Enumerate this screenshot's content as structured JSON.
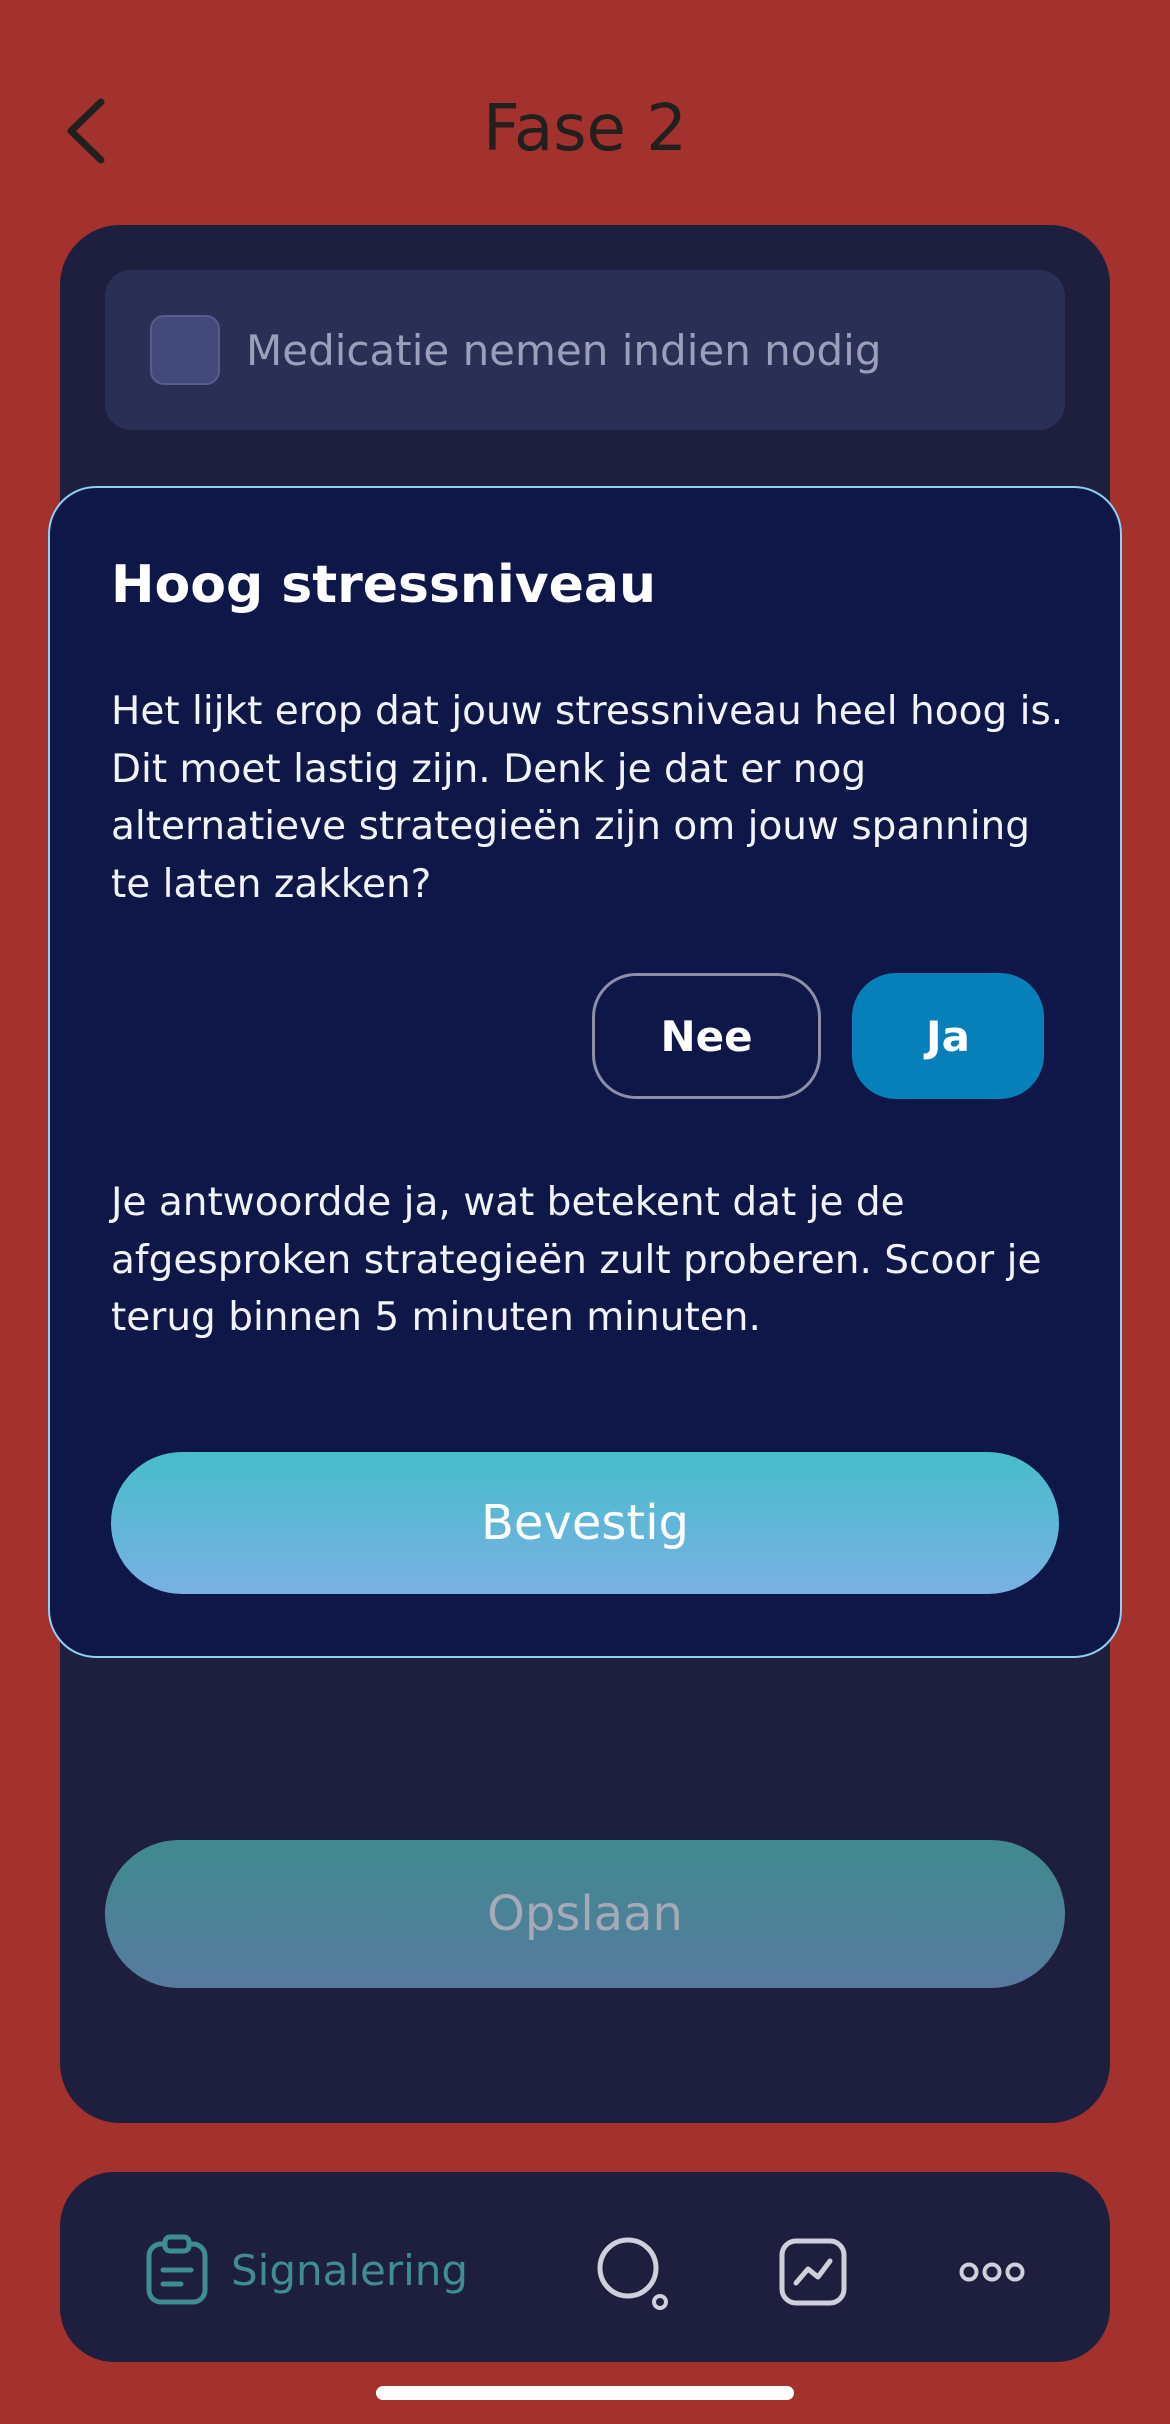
{
  "header": {
    "title": "Fase 2",
    "back_icon": "chevron-left-icon"
  },
  "checklist": {
    "item_label": "Medicatie nemen indien nodig",
    "checked": false
  },
  "modal": {
    "title": "Hoog stressniveau",
    "body": "Het lijkt erop dat jouw stressniveau heel hoog is. Dit moet lastig zijn. Denk je dat er nog alternatieve strategieën zijn om jouw spanning te laten zakken?",
    "no_label": "Nee",
    "yes_label": "Ja",
    "selected": "Ja",
    "answer_text": "Je antwoordde ja, wat betekent dat je de afgesproken strategieën zult proberen. Scoor je terug binnen 5 minuten minuten.",
    "confirm_label": "Bevestig"
  },
  "save_label": "Opslaan",
  "tab_bar": {
    "items": [
      {
        "label": "Signalering",
        "icon": "clipboard-icon",
        "active": true
      },
      {
        "label": "",
        "icon": "search-icon"
      },
      {
        "label": "",
        "icon": "chart-icon"
      },
      {
        "label": "",
        "icon": "more-icon"
      }
    ]
  },
  "colors": {
    "background": "#a3312d",
    "card": "#1e1f3e",
    "modal": "#0e1747",
    "accent_teal": "#3d8d92",
    "button_blue": "#0780ba"
  }
}
